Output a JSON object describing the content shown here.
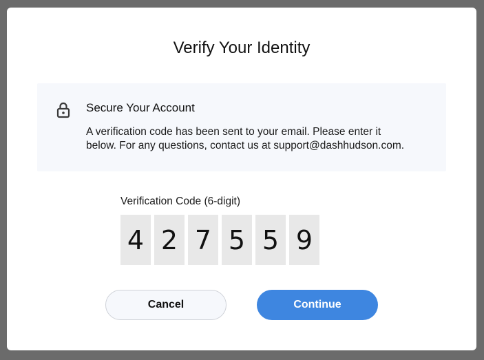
{
  "dialog": {
    "title": "Verify Your Identity",
    "info": {
      "icon": "lock-icon",
      "heading": "Secure Your Account",
      "message_line1": "A verification code has been sent to your email. Please enter it",
      "message_line2": "below. For any questions, contact us at support@dashhudson.com."
    },
    "code": {
      "label": "Verification Code (6-digit)",
      "digits": [
        "4",
        "2",
        "7",
        "5",
        "5",
        "9"
      ]
    },
    "buttons": {
      "cancel": "Cancel",
      "continue": "Continue"
    }
  },
  "colors": {
    "overlay": "#6b6b6b",
    "info_background": "#f6f8fc",
    "digit_background": "#e8e8e8",
    "primary": "#3e86e0"
  }
}
